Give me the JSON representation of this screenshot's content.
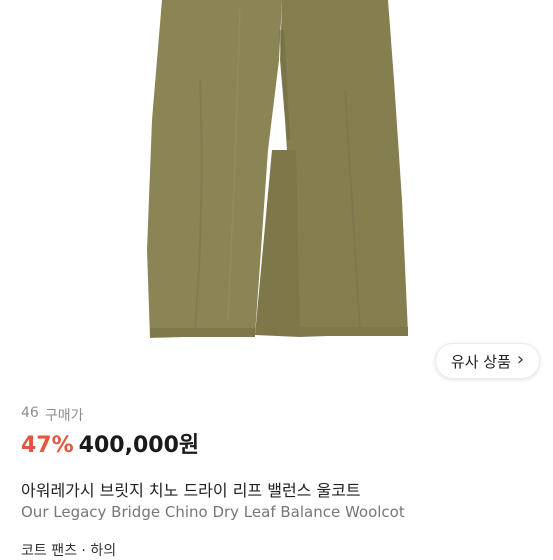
{
  "product": {
    "image_icon": "wide-leg-chino-pants",
    "colors": {
      "pants": "#8b8455",
      "pants_shadow": "#6f6a42",
      "discount": "#e8543d"
    },
    "similar_button": {
      "label": "유사 상품",
      "icon": "chevron-right-icon"
    },
    "purchase": {
      "count": "46",
      "label": "구매가"
    },
    "discount": "47%",
    "price": "400,000원",
    "title_ko": "아워레가시 브릿지 치노 드라이 리프 밸런스 울코트",
    "title_en": "Our Legacy Bridge Chino Dry Leaf Balance Woolcot",
    "tags": "코트 팬츠 · 하의"
  }
}
